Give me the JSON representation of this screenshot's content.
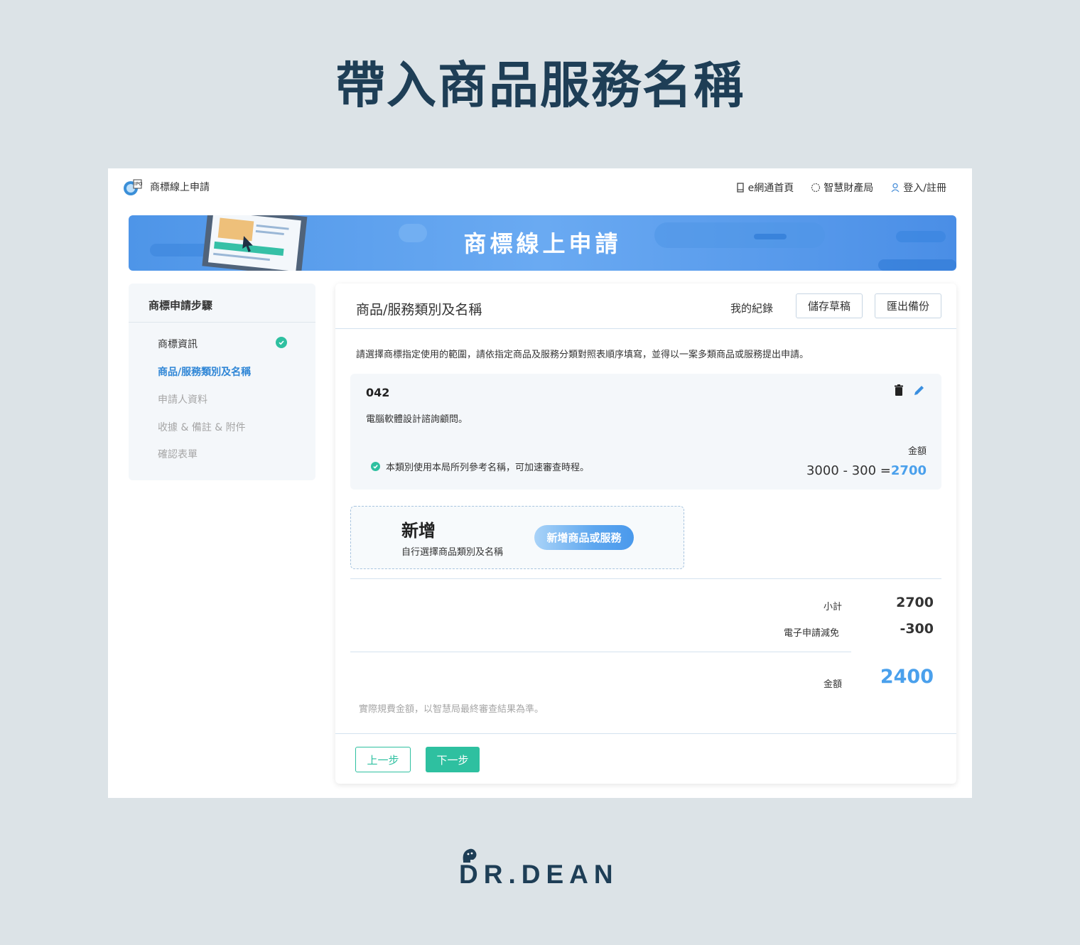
{
  "page_title": "帶入商品服務名稱",
  "colors": {
    "navy": "#1e3e56",
    "accent_blue": "#4aa0ec",
    "active_step": "#2f86d6",
    "teal": "#2ec0a0",
    "background": "#dce3e7"
  },
  "header": {
    "site_name": "商標線上申請",
    "nav": [
      {
        "label": "e網通首頁",
        "icon": "bookmark-icon"
      },
      {
        "label": "智慧財產局",
        "icon": "globe-icon"
      },
      {
        "label": "登入/註冊",
        "icon": "user-icon"
      }
    ]
  },
  "banner": {
    "title": "商標線上申請"
  },
  "sidebar": {
    "title": "商標申請步驟",
    "steps": [
      {
        "label": "商標資訊",
        "state": "done"
      },
      {
        "label": "商品/服務類別及名稱",
        "state": "active"
      },
      {
        "label": "申請人資料",
        "state": "todo"
      },
      {
        "label": "收據 & 備註 & 附件",
        "state": "todo"
      },
      {
        "label": "確認表單",
        "state": "todo"
      }
    ]
  },
  "panel": {
    "title": "商品/服務類別及名稱",
    "my_records": "我的紀錄",
    "save_draft": "儲存草稿",
    "export_backup": "匯出備份",
    "instruction": "請選擇商標指定使用的範圍，請依指定商品及服務分類對照表順序填寫，並得以一案多類商品或服務提出申請。"
  },
  "class_card": {
    "code": "042",
    "description": "電腦軟體設計諮詢顧問。",
    "note": "本類別使用本局所列參考名稱，可加速審查時程。",
    "amount_label": "金額",
    "formula": "3000 - 300 =",
    "amount": "2700"
  },
  "add_card": {
    "title": "新增",
    "subtitle": "自行選擇商品類別及名稱",
    "button": "新增商品或服務"
  },
  "summary": {
    "subtotal_label": "小計",
    "subtotal": "2700",
    "discount_label": "電子申請減免",
    "discount": "-300",
    "total_label": "金額",
    "total": "2400",
    "note": "實際規費金額，以智慧局最終審查結果為準。"
  },
  "footer": {
    "prev": "上一步",
    "next": "下一步"
  },
  "brand": {
    "text": "DR.DEAN"
  }
}
